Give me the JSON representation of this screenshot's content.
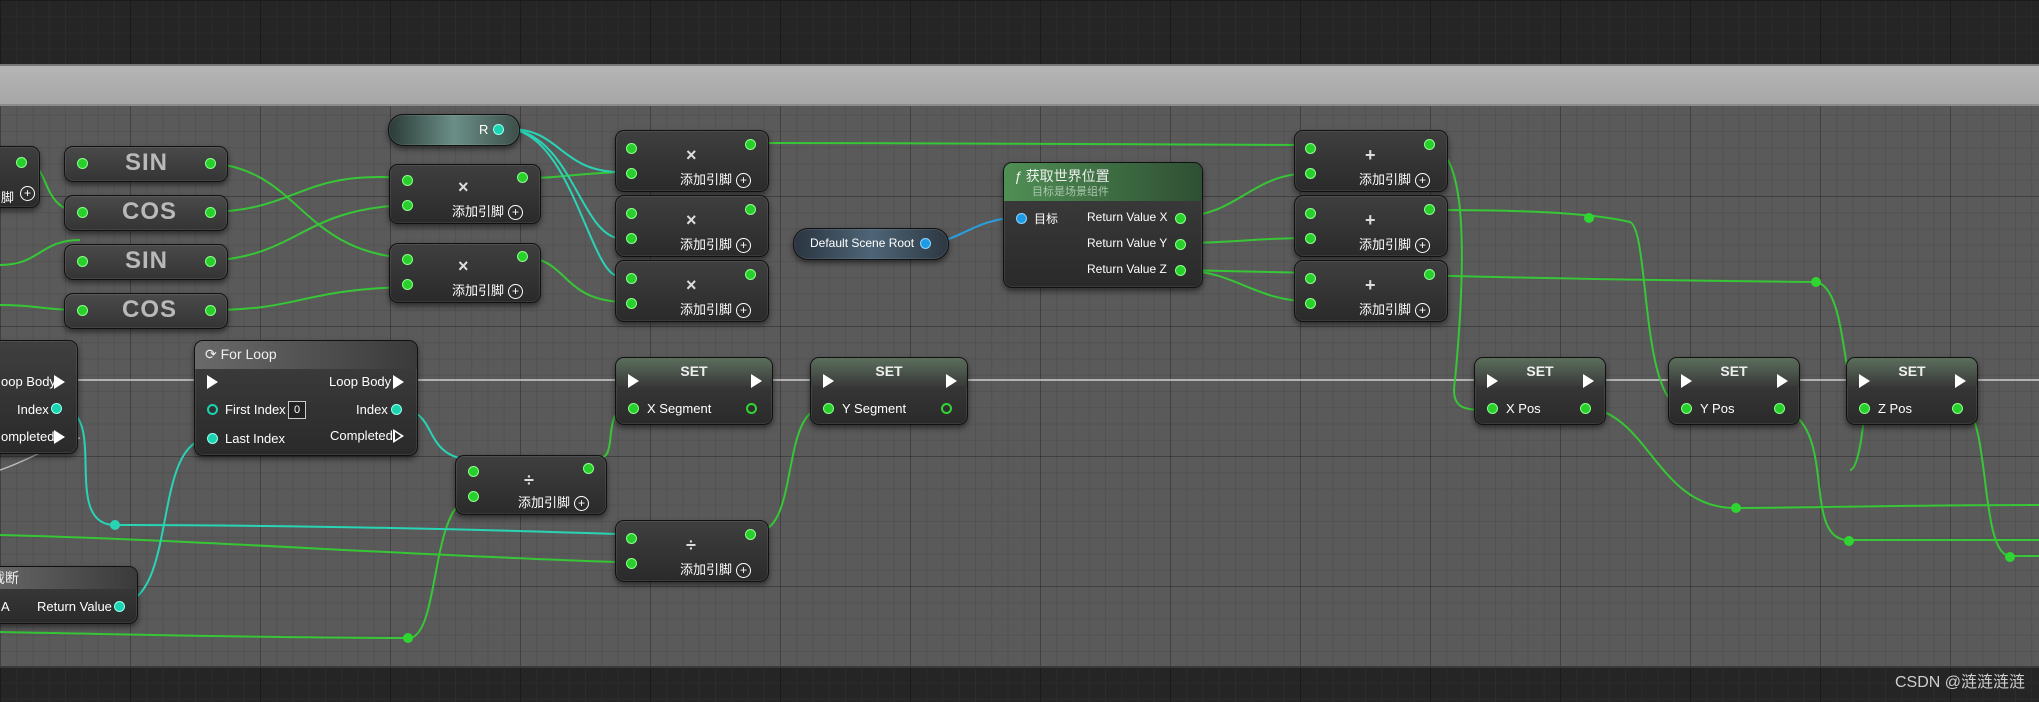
{
  "colors": {
    "float_wire": "#36c636",
    "int_wire": "#29d4b4",
    "object_wire": "#2a9fe0",
    "exec_wire": "#e6e6e6"
  },
  "trig_nodes": [
    {
      "label": "SIN"
    },
    {
      "label": "COS"
    },
    {
      "label": "SIN"
    },
    {
      "label": "COS"
    }
  ],
  "r_var": {
    "label": "R"
  },
  "add_pin_label": "添加引脚",
  "ops": {
    "multiply": "×",
    "add": "+",
    "divide": "÷"
  },
  "for_loop": {
    "title": "For Loop",
    "loop_body": "Loop Body",
    "first_index": "First Index",
    "first_index_value": "0",
    "index": "Index",
    "last_index": "Last Index",
    "completed": "Completed"
  },
  "partial_left_loop": {
    "loop_body": "oop Body",
    "index": "Index",
    "completed": "ompleted"
  },
  "partial_left_pin": "脚",
  "truncate_node": {
    "title": "截断",
    "input": "A",
    "return_value": "Return Value"
  },
  "default_scene_root": "Default Scene Root",
  "world_location": {
    "title": "获取世界位置",
    "subtitle": "目标是场景组件",
    "target": "目标",
    "rx": "Return Value X",
    "ry": "Return Value Y",
    "rz": "Return Value Z"
  },
  "set_nodes": [
    {
      "title": "SET",
      "var": "X Segment"
    },
    {
      "title": "SET",
      "var": "Y Segment"
    },
    {
      "title": "SET",
      "var": "X Pos"
    },
    {
      "title": "SET",
      "var": "Y Pos"
    },
    {
      "title": "SET",
      "var": "Z Pos"
    }
  ],
  "watermark": "CSDN @涟涟涟涟"
}
